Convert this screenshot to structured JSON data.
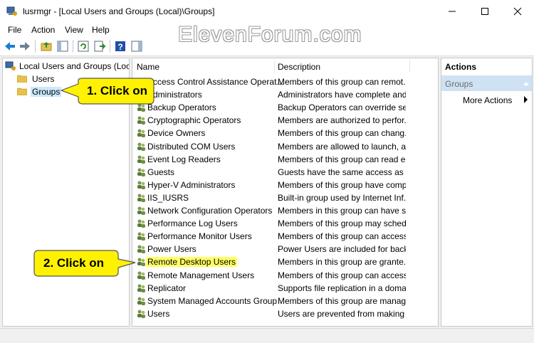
{
  "window": {
    "title": "lusrmgr - [Local Users and Groups (Local)\\Groups]"
  },
  "menu": [
    "File",
    "Action",
    "View",
    "Help"
  ],
  "watermark": "ElevenForum.com",
  "tree": {
    "root": "Local Users and Groups (Local)",
    "children": [
      "Users",
      "Groups"
    ]
  },
  "list": {
    "columns": [
      "Name",
      "Description"
    ],
    "rows": [
      {
        "name": "Access Control Assistance Operat...",
        "desc": "Members of this group can remot..."
      },
      {
        "name": "Administrators",
        "desc": "Administrators have complete and..."
      },
      {
        "name": "Backup Operators",
        "desc": "Backup Operators can override sec..."
      },
      {
        "name": "Cryptographic Operators",
        "desc": "Members are authorized to perfor..."
      },
      {
        "name": "Device Owners",
        "desc": "Members of this group can chang..."
      },
      {
        "name": "Distributed COM Users",
        "desc": "Members are allowed to launch, ac..."
      },
      {
        "name": "Event Log Readers",
        "desc": "Members of this group can read e..."
      },
      {
        "name": "Guests",
        "desc": "Guests have the same access as m..."
      },
      {
        "name": "Hyper-V Administrators",
        "desc": "Members of this group have comp..."
      },
      {
        "name": "IIS_IUSRS",
        "desc": "Built-in group used by Internet Inf..."
      },
      {
        "name": "Network Configuration Operators",
        "desc": "Members in this group can have s..."
      },
      {
        "name": "Performance Log Users",
        "desc": "Members of this group may sched..."
      },
      {
        "name": "Performance Monitor Users",
        "desc": "Members of this group can access ..."
      },
      {
        "name": "Power Users",
        "desc": "Power Users are included for back..."
      },
      {
        "name": "Remote Desktop Users",
        "desc": "Members in this group are grante..."
      },
      {
        "name": "Remote Management Users",
        "desc": "Members of this group can access ..."
      },
      {
        "name": "Replicator",
        "desc": "Supports file replication in a doma..."
      },
      {
        "name": "System Managed Accounts Group",
        "desc": "Members of this group are manag..."
      },
      {
        "name": "Users",
        "desc": "Users are prevented from making ..."
      }
    ]
  },
  "actions": {
    "title": "Actions",
    "group": "Groups",
    "more": "More Actions"
  },
  "callouts": {
    "one": "1. Click on",
    "two": "2. Click on"
  },
  "colors": {
    "callout_fill": "#fff200",
    "highlight": "#ffff66",
    "selected_bg": "#cce8ff",
    "actions_bg": "#cfe2f3"
  }
}
